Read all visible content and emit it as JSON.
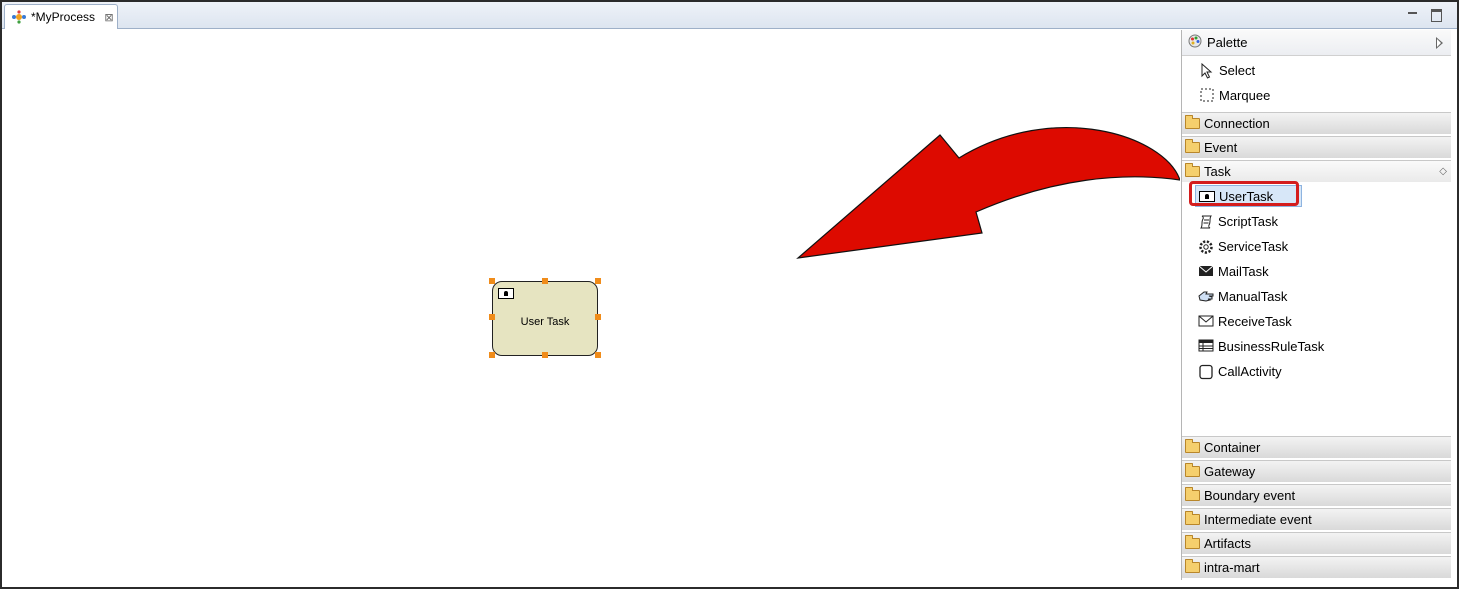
{
  "editor": {
    "tab_title": "*MyProcess",
    "tab_close": "⊠"
  },
  "canvas": {
    "user_task_label": "User Task"
  },
  "palette": {
    "title": "Palette",
    "tools": [
      {
        "label": "Select",
        "icon": "pointer-icon"
      },
      {
        "label": "Marquee",
        "icon": "marquee-icon"
      }
    ],
    "drawers_top": [
      {
        "label": "Connection"
      },
      {
        "label": "Event"
      },
      {
        "label": "Task"
      }
    ],
    "task_entries": [
      {
        "label": "UserTask",
        "icon": "user-task-icon",
        "selected": true
      },
      {
        "label": "ScriptTask",
        "icon": "script-task-icon"
      },
      {
        "label": "ServiceTask",
        "icon": "gear-icon"
      },
      {
        "label": "MailTask",
        "icon": "mail-icon"
      },
      {
        "label": "ManualTask",
        "icon": "hand-icon"
      },
      {
        "label": "ReceiveTask",
        "icon": "envelope-icon"
      },
      {
        "label": "BusinessRuleTask",
        "icon": "table-icon"
      },
      {
        "label": "CallActivity",
        "icon": "call-activity-icon"
      }
    ],
    "drawers_bottom": [
      {
        "label": "Container"
      },
      {
        "label": "Gateway"
      },
      {
        "label": "Boundary event"
      },
      {
        "label": "Intermediate event"
      },
      {
        "label": "Artifacts"
      },
      {
        "label": "intra-mart"
      }
    ]
  },
  "colors": {
    "annotation_arrow": "#dd0a00",
    "highlight_box": "#d41d1d",
    "task_fill": "#e6e4c1",
    "selection_handle": "#f08c1a"
  }
}
